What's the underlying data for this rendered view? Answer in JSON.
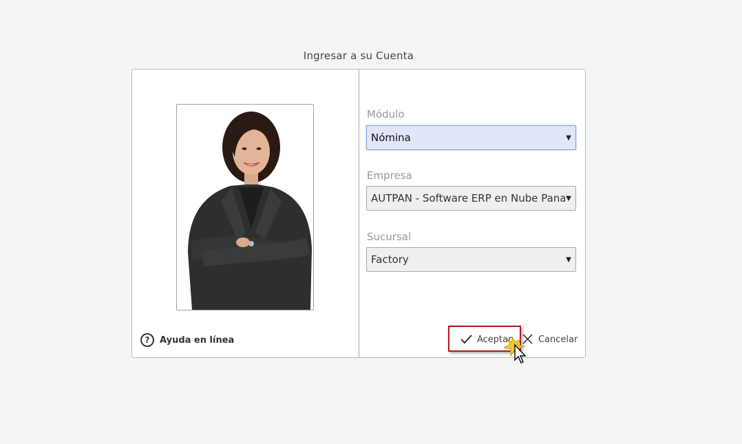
{
  "title": "Ingresar a su Cuenta",
  "help": {
    "label": "Ayuda en línea",
    "icon": "question-circle-icon"
  },
  "fields": {
    "modulo": {
      "label": "Módulo",
      "value": "Nómina"
    },
    "empresa": {
      "label": "Empresa",
      "value": "AUTPAN - Software ERP en Nube Panamá"
    },
    "sucursal": {
      "label": "Sucursal",
      "value": "Factory"
    }
  },
  "buttons": {
    "accept": {
      "label": "Aceptar",
      "icon": "checkmark-icon"
    },
    "cancel": {
      "label": "Cancelar",
      "icon": "close-icon"
    }
  },
  "colors": {
    "active_select_bg": "#e1e6fb",
    "highlight_border": "#b11a1a"
  }
}
